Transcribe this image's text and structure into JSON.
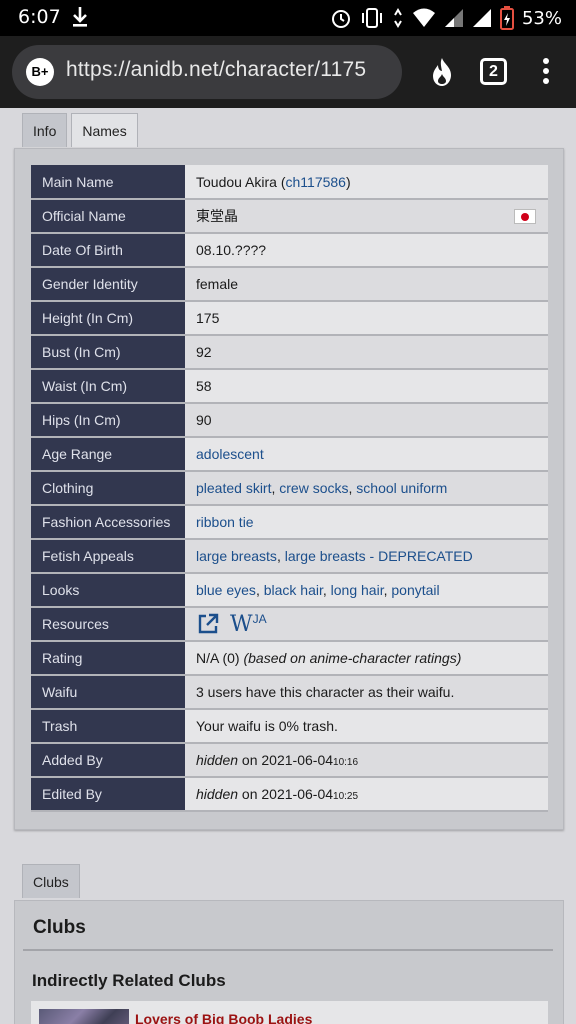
{
  "statusbar": {
    "time": "6:07",
    "battery": "53%"
  },
  "browser": {
    "secure_badge": "B+",
    "url": "https://anidb.net/character/1175",
    "tab_count": "2"
  },
  "tabs": [
    "Info",
    "Names"
  ],
  "info": {
    "main_name": {
      "label": "Main Name",
      "value": "Toudou Akira (",
      "link": "ch117586",
      "suffix": ")"
    },
    "official_name": {
      "label": "Official Name",
      "value": "東堂晶"
    },
    "dob": {
      "label": "Date Of Birth",
      "value": "08.10.????"
    },
    "gender": {
      "label": "Gender Identity",
      "value": "female"
    },
    "height": {
      "label": "Height (In Cm)",
      "value": "175"
    },
    "bust": {
      "label": "Bust (In Cm)",
      "value": "92"
    },
    "waist": {
      "label": "Waist (In Cm)",
      "value": "58"
    },
    "hips": {
      "label": "Hips (In Cm)",
      "value": "90"
    },
    "age": {
      "label": "Age Range",
      "value": "adolescent"
    },
    "clothing": {
      "label": "Clothing",
      "items": [
        "pleated skirt",
        "crew socks",
        "school uniform"
      ]
    },
    "fashion": {
      "label": "Fashion Accessories",
      "value": "ribbon tie"
    },
    "fetish": {
      "label": "Fetish Appeals",
      "items": [
        "large breasts",
        "large breasts - DEPRECATED"
      ]
    },
    "looks": {
      "label": "Looks",
      "items": [
        "blue eyes",
        "black hair",
        "long hair",
        "ponytail"
      ]
    },
    "resources": {
      "label": "Resources",
      "wiki_text": "W",
      "wiki_sup": "JA"
    },
    "rating": {
      "label": "Rating",
      "value": "N/A (0) ",
      "note": "(based on anime-character ratings)"
    },
    "waifu": {
      "label": "Waifu",
      "value": "3 users have this character as their waifu."
    },
    "trash": {
      "label": "Trash",
      "value": "Your waifu is 0% trash."
    },
    "added": {
      "label": "Added By",
      "who": "hidden",
      "on": " on 2021-06-04",
      "time": "10:16"
    },
    "edited": {
      "label": "Edited By",
      "who": "hidden",
      "on": " on 2021-06-04",
      "time": "10:25"
    }
  },
  "clubs": {
    "tab": "Clubs",
    "title": "Clubs",
    "subtitle": "Indirectly Related Clubs",
    "first_club": "Lovers of Big Boob Ladies"
  }
}
